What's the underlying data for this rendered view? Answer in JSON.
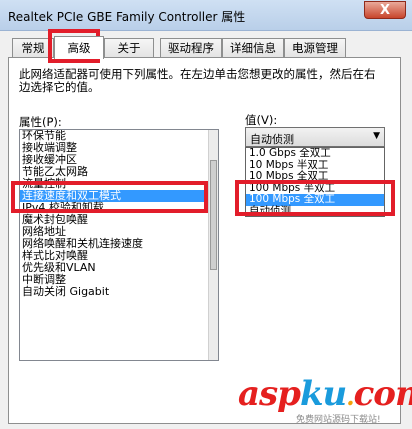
{
  "window": {
    "title": "Realtek PCIe GBE Family Controller 属性",
    "close_glyph": "X"
  },
  "tabs": [
    {
      "label": "常规",
      "active": false
    },
    {
      "label": "高级",
      "active": true
    },
    {
      "label": "关于",
      "active": false
    },
    {
      "label": "驱动程序",
      "active": false
    },
    {
      "label": "详细信息",
      "active": false
    },
    {
      "label": "电源管理",
      "active": false
    }
  ],
  "panel": {
    "description": "此网络适配器可使用下列属性。在左边单击您想更改的属性，然后在右边选择它的值。",
    "property_label": "属性(P):",
    "value_label": "值(V):",
    "properties": [
      "环保节能",
      "接收端调整",
      "接收缓冲区",
      "节能乙太网路",
      "流量控制",
      "连接速度和双工模式",
      "IPv4 校验和卸载",
      "魔术封包唤醒",
      "网络地址",
      "网络唤醒和关机连接速度",
      "样式比对唤醒",
      "优先级和VLAN",
      "中断调整",
      "自动关闭 Gigabit"
    ],
    "selected_property_index": 5,
    "combo_value": "自动侦测",
    "value_options": [
      "1.0 Gbps 全双工",
      "10 Mbps 半双工",
      "10 Mbps 全双工",
      "100 Mbps 半双工",
      "100 Mbps 全双工",
      "自动侦测"
    ],
    "selected_option_index": 4
  },
  "watermark": {
    "asp": "asp",
    "ku": "ku",
    "dot": ".",
    "com": "com",
    "sub": "免费网站源码下载站!"
  },
  "annotation_color": "#e21d2a",
  "selection_color": "#3399ff"
}
